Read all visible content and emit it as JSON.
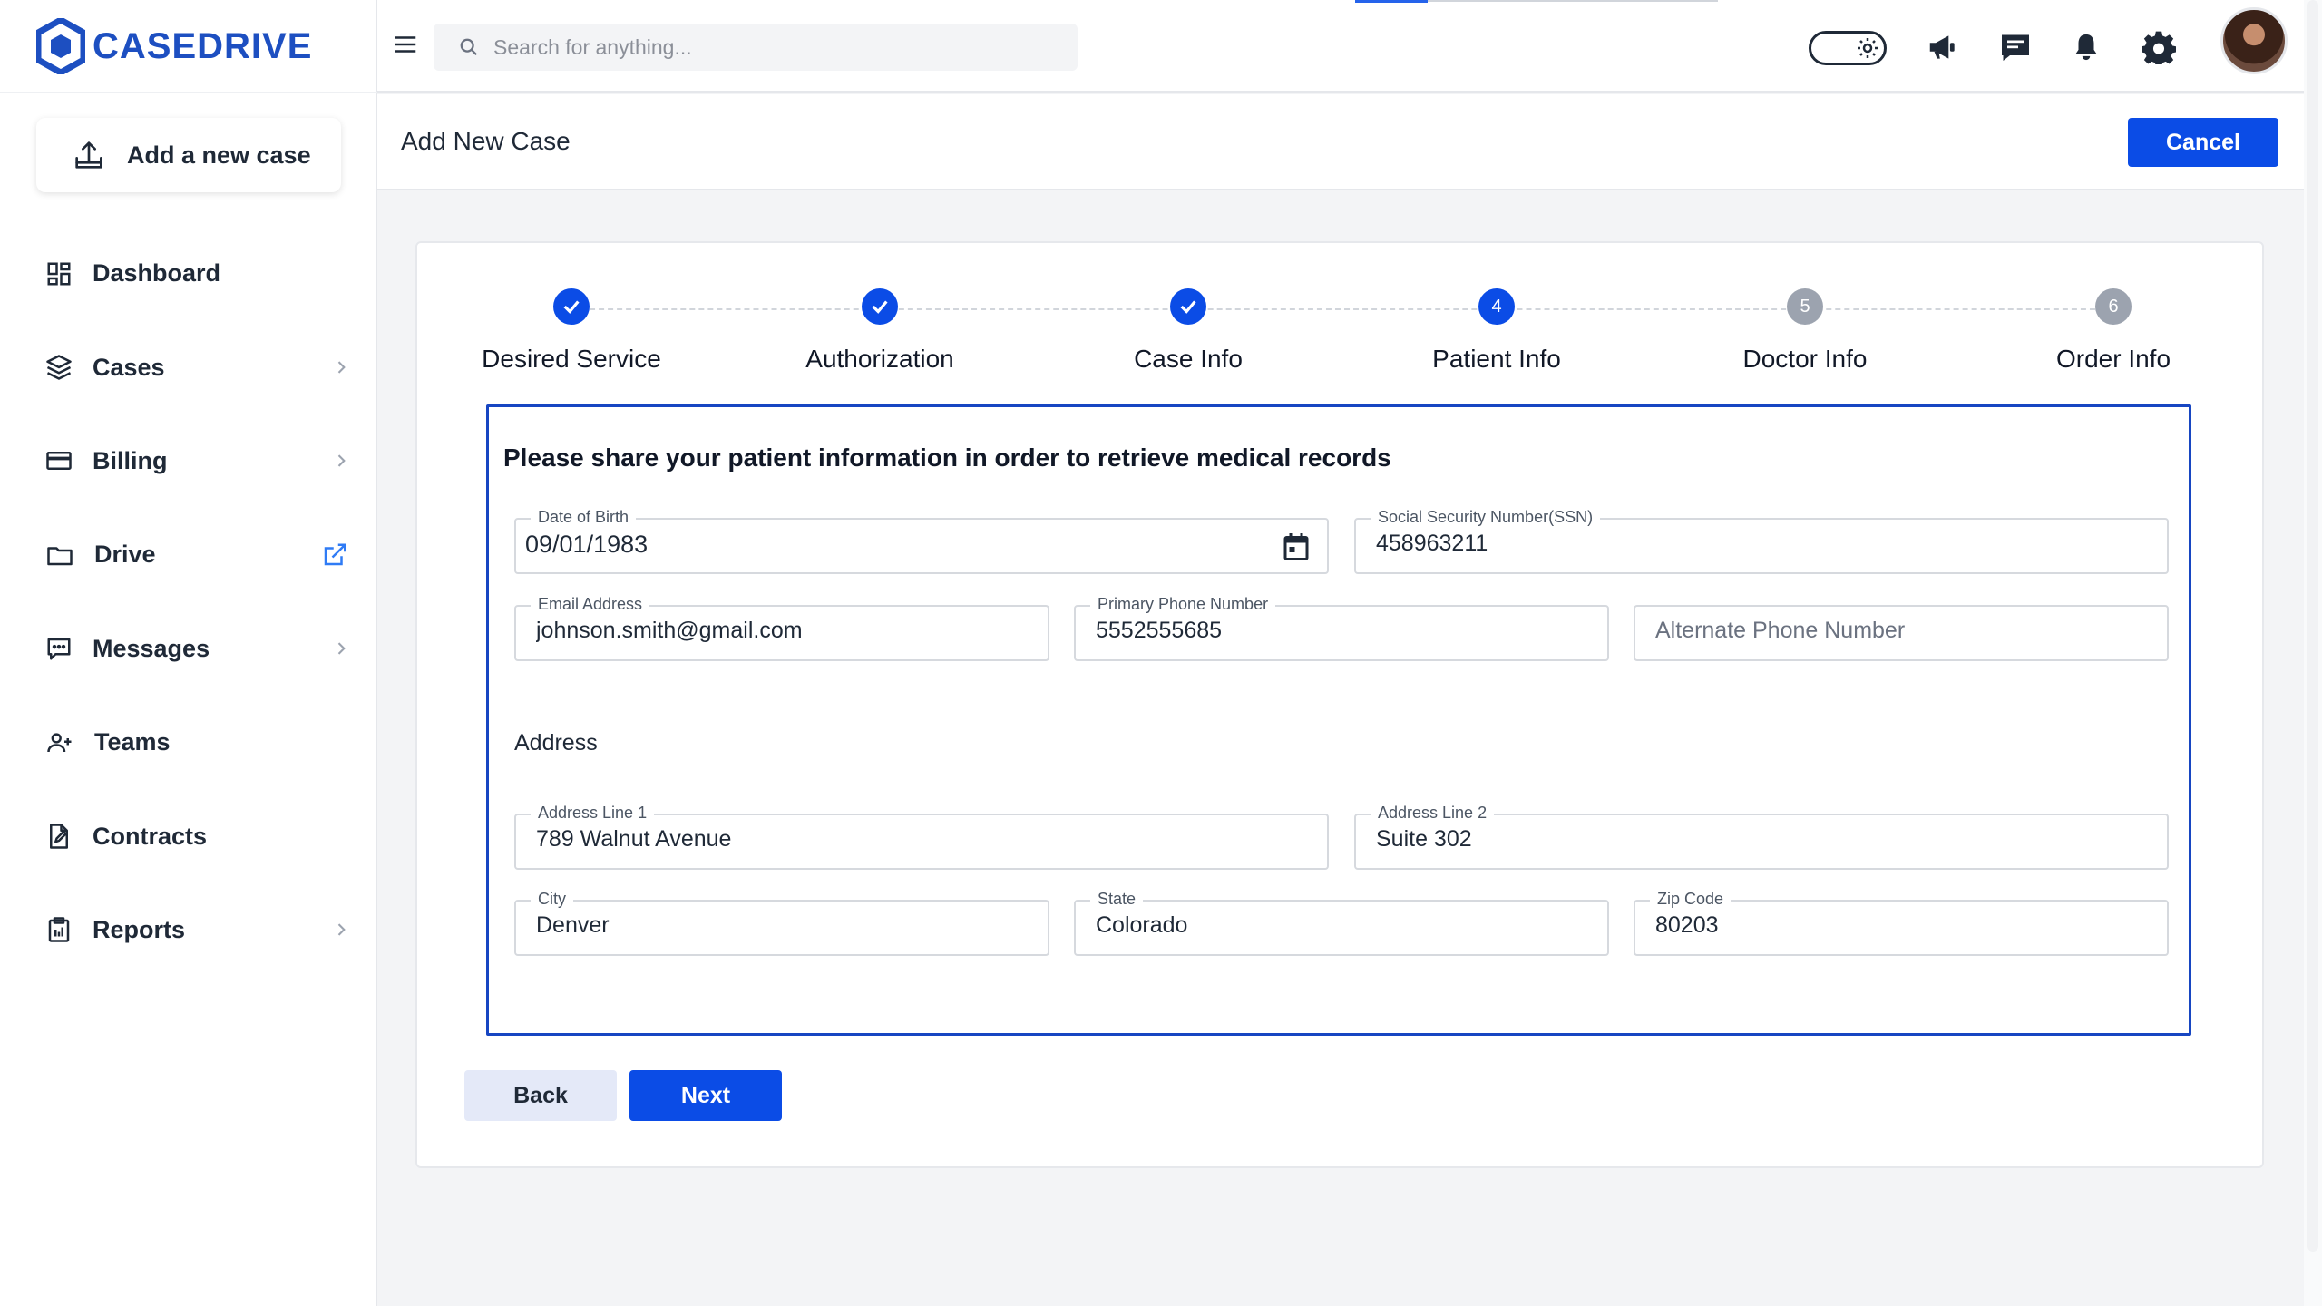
{
  "app": {
    "name": "CASEDRIVE",
    "brand_color": "#1d4fc1",
    "accent_color": "#0b4ce6"
  },
  "sidebar": {
    "add_case_label": "Add a new case",
    "items": [
      {
        "label": "Dashboard",
        "icon": "grid-icon",
        "has_chevron": false
      },
      {
        "label": "Cases",
        "icon": "layers-icon",
        "has_chevron": true
      },
      {
        "label": "Billing",
        "icon": "credit-card-icon",
        "has_chevron": true
      },
      {
        "label": "Drive",
        "icon": "folder-icon",
        "external_link": true
      },
      {
        "label": "Messages",
        "icon": "message-square-icon",
        "has_chevron": true
      },
      {
        "label": "Teams",
        "icon": "users-icon",
        "has_chevron": false
      },
      {
        "label": "Contracts",
        "icon": "file-edit-icon",
        "has_chevron": false
      },
      {
        "label": "Reports",
        "icon": "clipboard-icon",
        "has_chevron": true
      }
    ]
  },
  "topbar": {
    "search_placeholder": "Search for anything...",
    "icons": [
      "theme-toggle-icon",
      "megaphone-icon",
      "chat-icon",
      "bell-icon",
      "gear-icon",
      "avatar"
    ]
  },
  "header": {
    "title": "Add New Case",
    "cancel_label": "Cancel"
  },
  "stepper": {
    "steps": [
      {
        "label": "Desired Service",
        "state": "done",
        "number": "1"
      },
      {
        "label": "Authorization",
        "state": "done",
        "number": "2"
      },
      {
        "label": "Case Info",
        "state": "done",
        "number": "3"
      },
      {
        "label": "Patient Info",
        "state": "active",
        "number": "4"
      },
      {
        "label": "Doctor Info",
        "state": "pending",
        "number": "5"
      },
      {
        "label": "Order Info",
        "state": "pending",
        "number": "6"
      }
    ]
  },
  "form": {
    "heading": "Please share your patient information in order to retrieve medical records",
    "dob": {
      "label": "Date of Birth",
      "value": "09/01/1983"
    },
    "ssn": {
      "label": "Social Security Number(SSN)",
      "value": "458963211"
    },
    "email": {
      "label": "Email Address",
      "value": "johnson.smith@gmail.com"
    },
    "primary_phone": {
      "label": "Primary Phone Number",
      "value": "5552555685"
    },
    "alt_phone": {
      "placeholder": "Alternate Phone Number",
      "value": ""
    },
    "address_section_label": "Address",
    "address1": {
      "label": "Address Line 1",
      "value": "789 Walnut Avenue"
    },
    "address2": {
      "label": "Address Line 2",
      "value": "Suite 302"
    },
    "city": {
      "label": "City",
      "value": "Denver"
    },
    "state": {
      "label": "State",
      "value": "Colorado"
    },
    "zip": {
      "label": "Zip Code",
      "value": "80203"
    }
  },
  "actions": {
    "back_label": "Back",
    "next_label": "Next"
  }
}
